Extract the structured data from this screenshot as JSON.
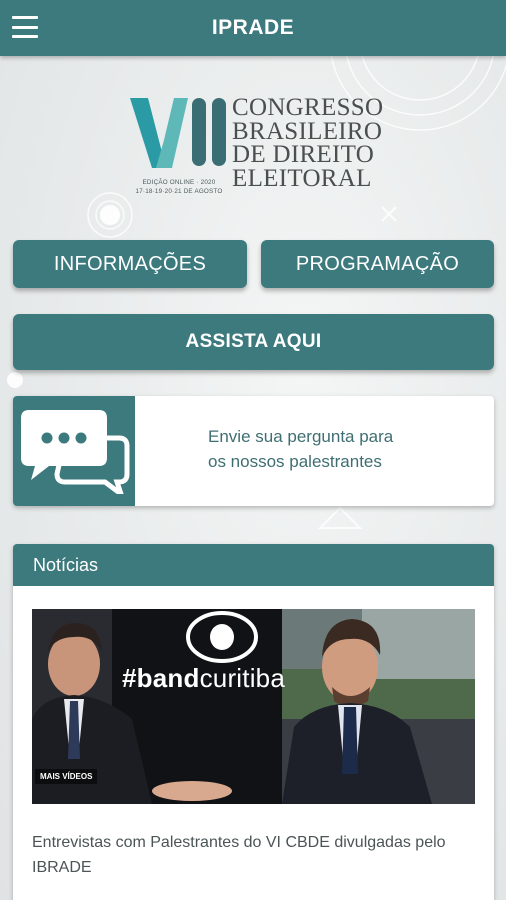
{
  "header": {
    "title": "IPRADE",
    "menu_icon": "hamburger-menu-icon"
  },
  "logo": {
    "numeral": "VII",
    "lines": [
      "CONGRESSO",
      "BRASILEIRO",
      "DE DIREITO",
      "ELEITORAL"
    ],
    "edition": "EDIÇÃO ONLINE · 2020",
    "dates": "17·18·19·20·21 DE AGOSTO",
    "colors": {
      "v_left": "#2a9aa4",
      "v_right": "#5fb8b8",
      "bars": "#3a6e74"
    }
  },
  "buttons": {
    "info": "INFORMAÇÕES",
    "programacao": "PROGRAMAÇÃO",
    "assista": "ASSISTA AQUI"
  },
  "ask_card": {
    "icon": "chat-bubbles-icon",
    "line1": "Envie sua pergunta para",
    "line2": "os nossos palestrantes"
  },
  "news": {
    "header": "Notícias",
    "items": [
      {
        "thumbnail_tag_bold": "#band",
        "thumbnail_tag_light": "curitiba",
        "thumbnail_overlay": "MAIS VÍDEOS",
        "title": "Entrevistas com Palestrantes do VI CBDE divulgadas pelo IBRADE"
      }
    ]
  },
  "theme": {
    "primary": "#3c7a7e",
    "text_accent": "#3f6e72"
  }
}
